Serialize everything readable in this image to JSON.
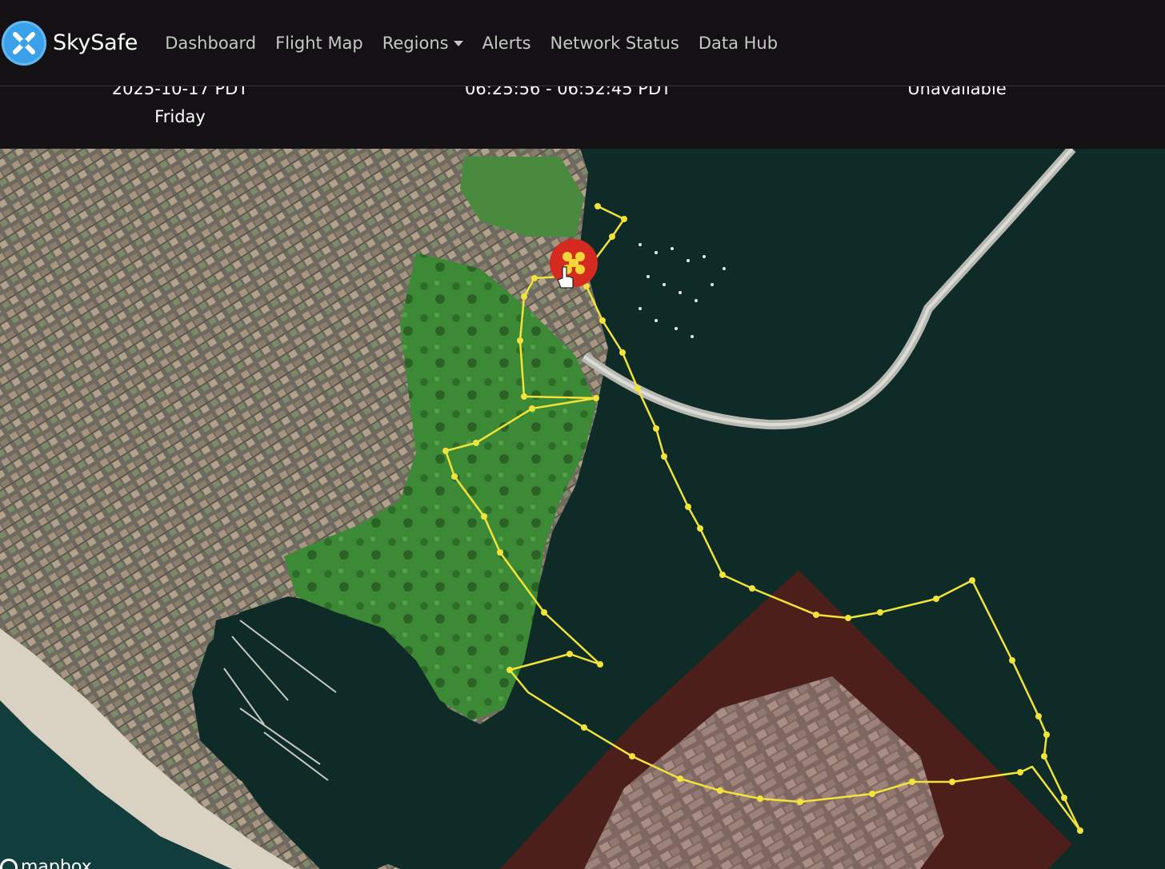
{
  "brand": {
    "name": "SkySafe",
    "logo_icon": "crossed-circle-icon",
    "logo_color": "#3aa0e8"
  },
  "nav": {
    "items": [
      {
        "label": "Dashboard"
      },
      {
        "label": "Flight Map"
      },
      {
        "label": "Regions",
        "dropdown": true
      },
      {
        "label": "Alerts"
      },
      {
        "label": "Network Status"
      },
      {
        "label": "Data Hub"
      }
    ]
  },
  "flight_info": {
    "date": "2025-10-17 PDT",
    "day": "Friday",
    "time_range": "06:25:56 - 06:52:45 PDT",
    "status": "Unavailable"
  },
  "map": {
    "attribution": "mapbox",
    "track_color": "#f2e33a",
    "restricted_zone_color": "#5a1d18",
    "drone_marker_color": "#d52a20",
    "drone_icon": "drone-icon"
  }
}
